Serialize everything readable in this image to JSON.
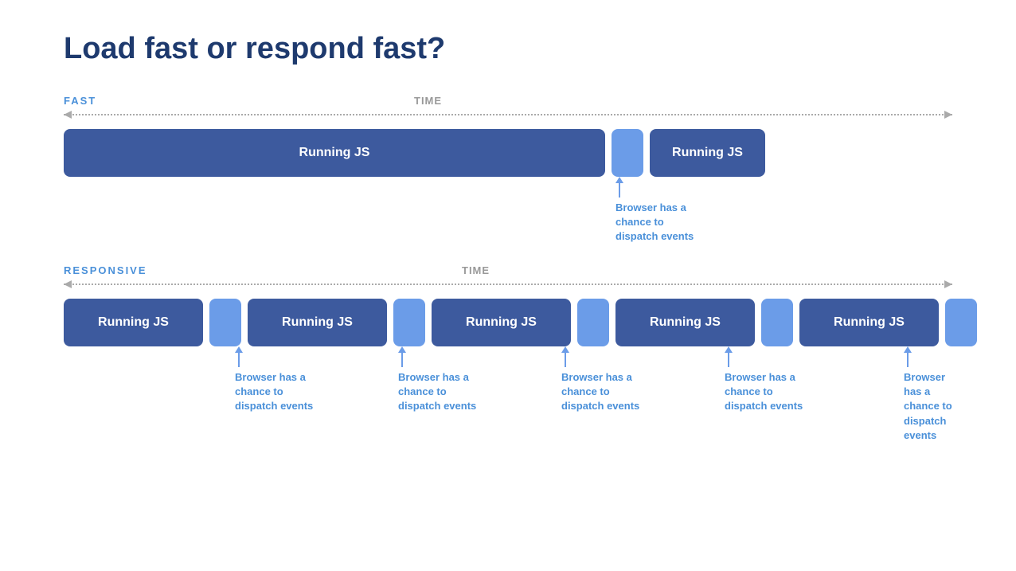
{
  "title": "Load fast or respond fast?",
  "fast_section": {
    "label": "FAST",
    "time_label": "TIME",
    "running_js_label": "Running JS",
    "block1_width": 680,
    "block_small_width": 40,
    "block2_width": 140,
    "annotation": {
      "text_line1": "Browser has a",
      "text_line2": "chance to",
      "text_line3": "dispatch events"
    }
  },
  "responsive_section": {
    "label": "RESPONSIVE",
    "time_label": "TIME",
    "running_js_label": "Running JS",
    "annotation": {
      "text_line1": "Browser has a",
      "text_line2": "chance to",
      "text_line3": "dispatch events"
    }
  }
}
